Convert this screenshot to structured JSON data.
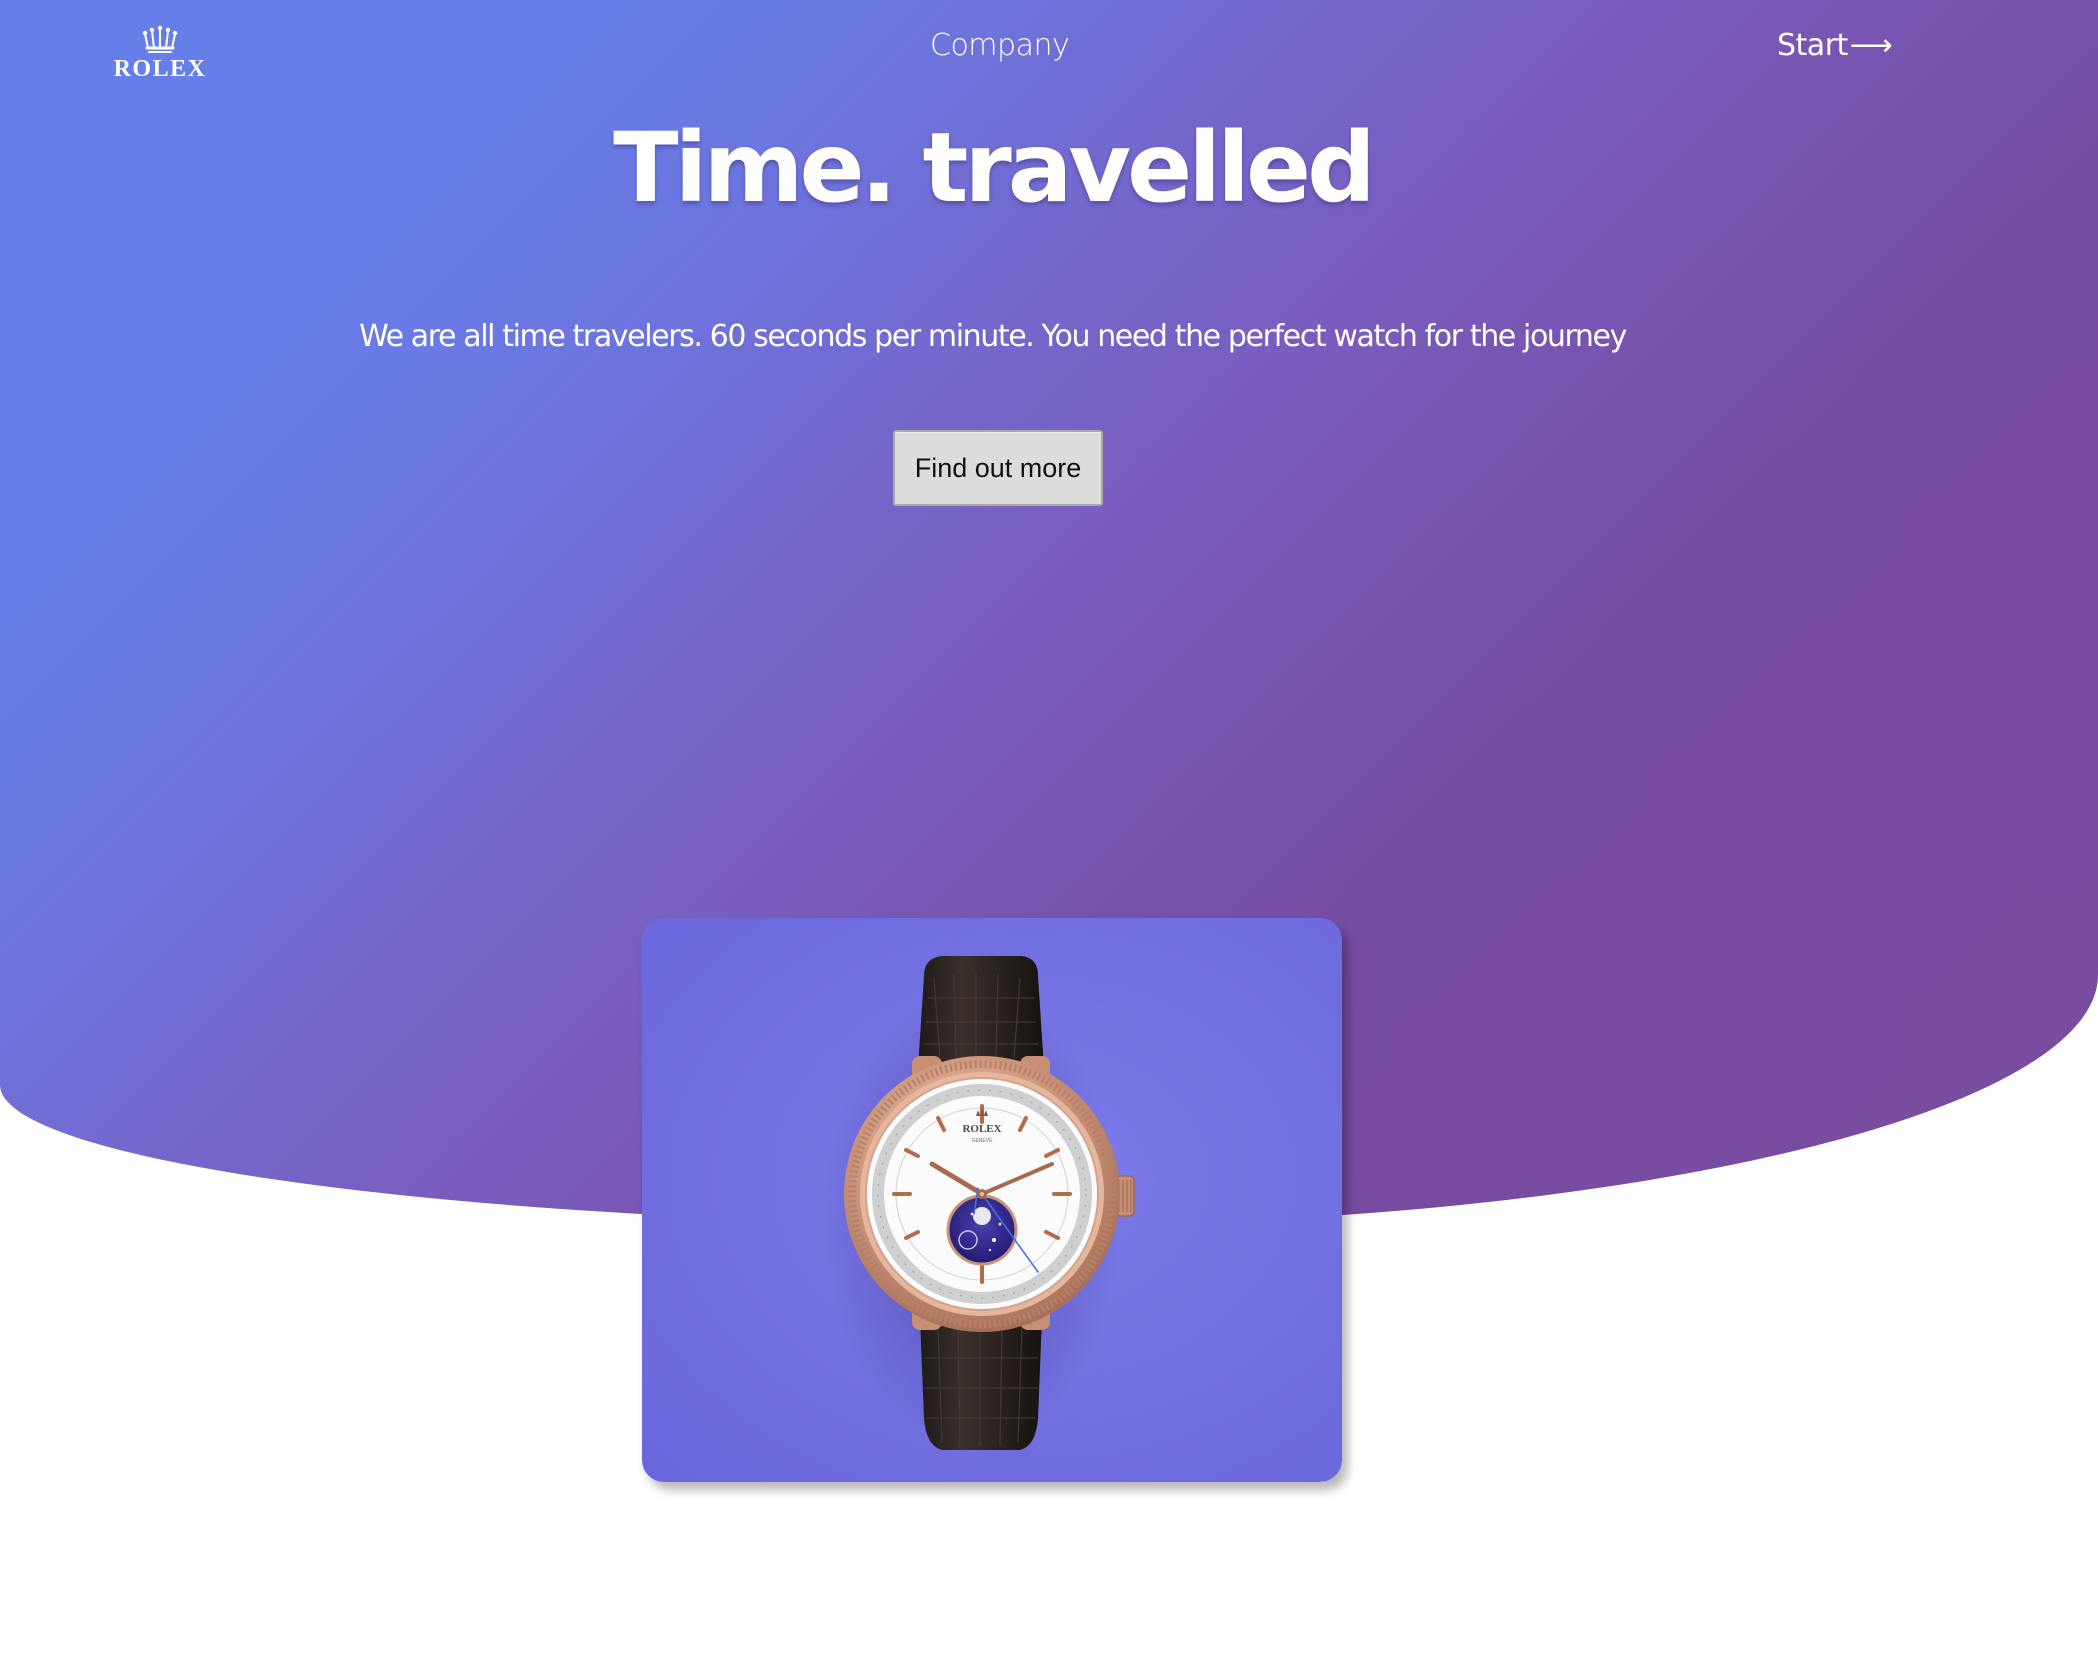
{
  "brand": {
    "wordmark": "ROLEX",
    "logo_icon": "crown-icon"
  },
  "nav": {
    "company_label": "Company",
    "start_label": "Start",
    "start_icon": "arrow-right-icon",
    "start_arrow_glyph": "⟶"
  },
  "hero": {
    "title": "Time. travelled",
    "subtitle": "We are all time travelers. 60 seconds per minute. You need the perfect watch for the journey",
    "cta_label": "Find out more"
  },
  "product": {
    "image": "watch-image",
    "dial_text": "ROLEX",
    "dial_subtext": "GENEVE"
  },
  "colors": {
    "gradient_start": "#667eea",
    "gradient_end": "#764ba2",
    "card_background": "#7471e2",
    "text_on_hero": "#ffffff",
    "button_background": "#dcdcdc"
  }
}
